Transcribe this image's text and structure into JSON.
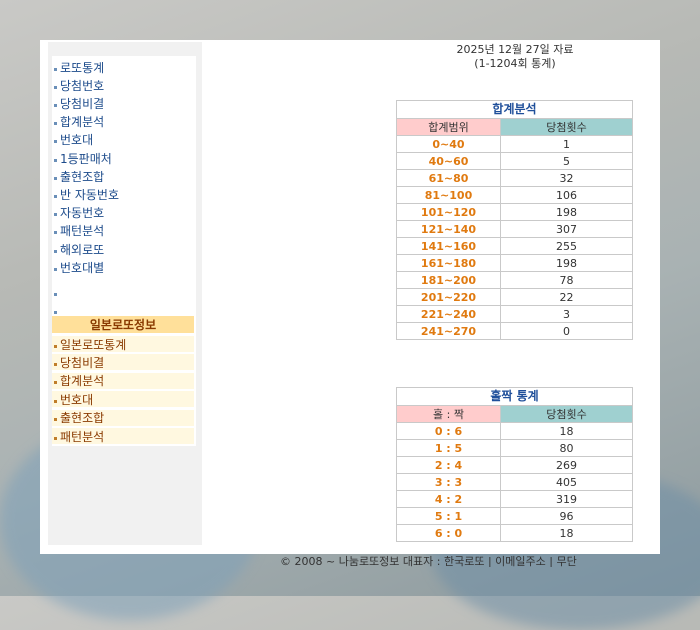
{
  "header": {
    "date_line": "2025년 12월 27일 자료",
    "range_line": "(1-1204회 통계)"
  },
  "sidebar": {
    "menu": [
      {
        "label": "로또통계"
      },
      {
        "label": "당첨번호"
      },
      {
        "label": "당첨비결"
      },
      {
        "label": "합계분석"
      },
      {
        "label": "번호대"
      },
      {
        "label": "1등판매처"
      },
      {
        "label": "출현조합"
      },
      {
        "label": "반 자동번호"
      },
      {
        "label": "자동번호"
      },
      {
        "label": "패턴분석"
      },
      {
        "label": "해외로또"
      },
      {
        "label": "번호대별"
      }
    ],
    "japan_title": "일본로또정보",
    "japan_menu": [
      {
        "label": "일본로또통계"
      },
      {
        "label": "당첨비결"
      },
      {
        "label": "합계분석"
      },
      {
        "label": "번호대"
      },
      {
        "label": "출현조합"
      },
      {
        "label": "패턴분석"
      }
    ]
  },
  "sum_table": {
    "caption": "합계분석",
    "col1": "합계범위",
    "col2": "당첨횟수",
    "rows": [
      {
        "range": "0~40",
        "count": "1"
      },
      {
        "range": "40~60",
        "count": "5"
      },
      {
        "range": "61~80",
        "count": "32"
      },
      {
        "range": "81~100",
        "count": "106"
      },
      {
        "range": "101~120",
        "count": "198"
      },
      {
        "range": "121~140",
        "count": "307"
      },
      {
        "range": "141~160",
        "count": "255"
      },
      {
        "range": "161~180",
        "count": "198"
      },
      {
        "range": "181~200",
        "count": "78"
      },
      {
        "range": "201~220",
        "count": "22"
      },
      {
        "range": "221~240",
        "count": "3"
      },
      {
        "range": "241~270",
        "count": "0"
      }
    ]
  },
  "odd_even_table": {
    "caption": "홀짝 통계",
    "col1": "홀 : 짝",
    "col2": "당첨횟수",
    "rows": [
      {
        "ratio": "0 : 6",
        "count": "18"
      },
      {
        "ratio": "1 : 5",
        "count": "80"
      },
      {
        "ratio": "2 : 4",
        "count": "269"
      },
      {
        "ratio": "3 : 3",
        "count": "405"
      },
      {
        "ratio": "4 : 2",
        "count": "319"
      },
      {
        "ratio": "5 : 1",
        "count": "96"
      },
      {
        "ratio": "6 : 0",
        "count": "18"
      }
    ]
  },
  "footer": {
    "text": "© 2008 ~ 나눔로또정보 대표자 : 한국로또 | 이메일주소 | 무단"
  }
}
